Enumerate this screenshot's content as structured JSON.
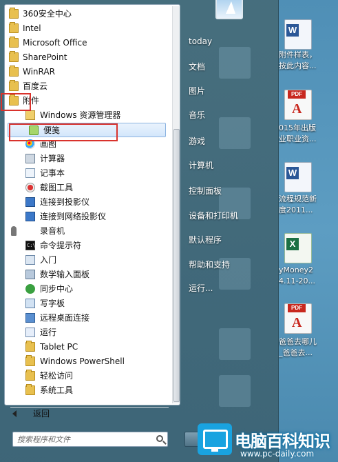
{
  "program_list": [
    {
      "label": "360安全中心",
      "icon": "folder-icon",
      "level": 1
    },
    {
      "label": "Intel",
      "icon": "folder-icon",
      "level": 1
    },
    {
      "label": "Microsoft Office",
      "icon": "folder-icon",
      "level": 1
    },
    {
      "label": "SharePoint",
      "icon": "folder-icon",
      "level": 1
    },
    {
      "label": "WinRAR",
      "icon": "folder-icon",
      "level": 1
    },
    {
      "label": "百度云",
      "icon": "folder-icon",
      "level": 1
    },
    {
      "label": "附件",
      "icon": "folder-icon",
      "level": 1
    },
    {
      "label": "Windows 资源管理器",
      "icon": "explorer-icon",
      "level": 2
    },
    {
      "label": "便笺",
      "icon": "sticky-notes-icon",
      "level": 2
    },
    {
      "label": "画图",
      "icon": "paint-icon",
      "level": 2
    },
    {
      "label": "计算器",
      "icon": "calculator-icon",
      "level": 2
    },
    {
      "label": "记事本",
      "icon": "notepad-icon",
      "level": 2
    },
    {
      "label": "截图工具",
      "icon": "snipping-tool-icon",
      "level": 2
    },
    {
      "label": "连接到投影仪",
      "icon": "projector-icon",
      "level": 2
    },
    {
      "label": "连接到网络投影仪",
      "icon": "network-projector-icon",
      "level": 2
    },
    {
      "label": "录音机",
      "icon": "microphone-icon",
      "level": 2
    },
    {
      "label": "命令提示符",
      "icon": "command-prompt-icon",
      "level": 2
    },
    {
      "label": "入门",
      "icon": "getting-started-icon",
      "level": 2
    },
    {
      "label": "数学输入面板",
      "icon": "math-input-icon",
      "level": 2
    },
    {
      "label": "同步中心",
      "icon": "sync-center-icon",
      "level": 2
    },
    {
      "label": "写字板",
      "icon": "wordpad-icon",
      "level": 2
    },
    {
      "label": "远程桌面连接",
      "icon": "remote-desktop-icon",
      "level": 2
    },
    {
      "label": "运行",
      "icon": "run-icon",
      "level": 2
    },
    {
      "label": "Tablet PC",
      "icon": "folder-icon",
      "level": 2
    },
    {
      "label": "Windows PowerShell",
      "icon": "folder-icon",
      "level": 2
    },
    {
      "label": "轻松访问",
      "icon": "folder-icon",
      "level": 2
    },
    {
      "label": "系统工具",
      "icon": "folder-icon",
      "level": 2
    }
  ],
  "selected_item": "便笺",
  "back_label": "返回",
  "search": {
    "placeholder": "搜索程序和文件"
  },
  "right_links": [
    "today",
    "文档",
    "图片",
    "音乐",
    "游戏",
    "计算机",
    "控制面板",
    "设备和打印机",
    "默认程序",
    "帮助和支持",
    "运行..."
  ],
  "desktop_icons": [
    {
      "icon": "word-doc-icon",
      "lines": [
        "附件样表，",
        "按此内容..."
      ]
    },
    {
      "icon": "pdf-icon",
      "lines": [
        "015年出版",
        "业职业资..."
      ]
    },
    {
      "icon": "word-doc-icon",
      "lines": [
        "流程规范新",
        "度2011..."
      ]
    },
    {
      "icon": "excel-icon",
      "lines": [
        "yMoney2",
        "4.11-20..."
      ]
    },
    {
      "icon": "pdf-icon",
      "lines": [
        "爸爸去哪儿",
        "_爸爸去..."
      ]
    }
  ],
  "highlight_color": "#d9322c",
  "watermark": {
    "title": "电脑百科知识",
    "url": "www.pc-daily.com"
  }
}
